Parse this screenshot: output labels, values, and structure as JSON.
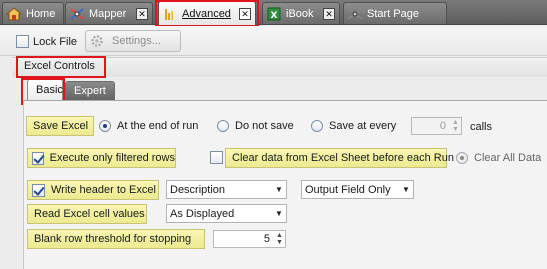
{
  "tabs": [
    {
      "label": "Home",
      "icon": "home-icon"
    },
    {
      "label": "Mapper",
      "icon": "mapper-icon"
    },
    {
      "label": "Advanced",
      "icon": "advanced-icon"
    },
    {
      "label": "iBook",
      "icon": "excel-book-icon"
    },
    {
      "label": "Start Page",
      "icon": "start-page-icon"
    }
  ],
  "active_tab": "Advanced",
  "close_glyph": "✕",
  "toolbar": {
    "lock_file_label": "Lock File",
    "lock_file_checked": false,
    "settings_label": "Settings..."
  },
  "group": {
    "title": "Excel Controls"
  },
  "subtabs": [
    "Basic",
    "Expert"
  ],
  "active_subtab": "Basic",
  "basic": {
    "save_excel_label": "Save Excel",
    "save_options": [
      {
        "label": "At the end of run",
        "selected": true
      },
      {
        "label": "Do not save",
        "selected": false
      },
      {
        "label": "Save at every",
        "selected": false
      }
    ],
    "save_every_value": "0",
    "save_every_unit": "calls",
    "execute_filtered_label": "Execute only filtered rows",
    "execute_filtered_checked": true,
    "clear_data_label": "Clear data from Excel Sheet before each Run",
    "clear_data_checked": false,
    "clear_all_label": "Clear All Data",
    "write_header_label": "Write header to Excel",
    "write_header_checked": true,
    "header_source_value": "Description",
    "output_field_value": "Output Field Only",
    "read_cell_label": "Read Excel cell values",
    "read_cell_value": "As Displayed",
    "blank_row_label": "Blank row threshold for stopping",
    "blank_row_value": "5"
  },
  "colors": {
    "highlight": "#f5f3a8",
    "callout_red": "#e0141e",
    "tab_strip": "#6b6b6b"
  }
}
